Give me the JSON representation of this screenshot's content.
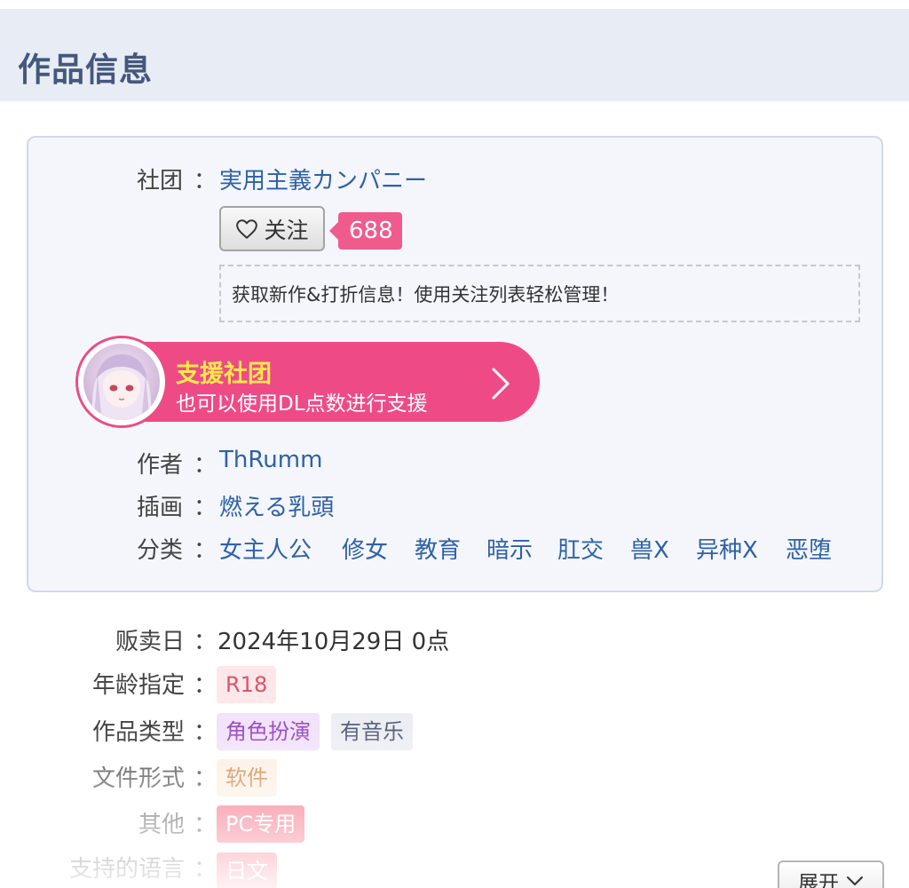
{
  "header": {
    "title": "作品信息"
  },
  "circle": {
    "label": "社团",
    "name": "実用主義カンパニー",
    "follow_label": "关注",
    "follower_count": "688",
    "notice": "获取新作&打折信息！使用关注列表轻松管理！"
  },
  "support": {
    "title": "支援社团",
    "subtitle": "也可以使用DL点数进行支援"
  },
  "author": {
    "label": "作者",
    "name": "ThRumm"
  },
  "illustrator": {
    "label": "插画",
    "name": "燃える乳頭"
  },
  "genre": {
    "label": "分类",
    "items": [
      "女主人公",
      "修女",
      "教育",
      "暗示",
      "肛交",
      "兽X",
      "异种X",
      "恶堕"
    ]
  },
  "details": {
    "release": {
      "label": "贩卖日",
      "value": "2024年10月29日 0点"
    },
    "age": {
      "label": "年龄指定",
      "tag": "R18"
    },
    "work_type": {
      "label": "作品类型",
      "tags": [
        "角色扮演",
        "有音乐"
      ]
    },
    "file_format": {
      "label": "文件形式",
      "tag": "软件"
    },
    "other": {
      "label": "其他",
      "tag": "PC专用"
    },
    "languages": {
      "label": "支持的语言",
      "tag": "日文"
    }
  },
  "colon": "：",
  "expand_button": {
    "label": "展开"
  },
  "icons": {
    "heart": "heart-outline-icon",
    "chevron_right": "chevron-right-icon",
    "chevron_down": "chevron-down-icon"
  },
  "colors": {
    "header_bg": "#e8ecf4",
    "header_text": "#44587e",
    "link": "#2e61a8",
    "support_pink": "#ee4b86",
    "support_title": "#ffe94a",
    "badge_pink": "#ef5b8d"
  }
}
